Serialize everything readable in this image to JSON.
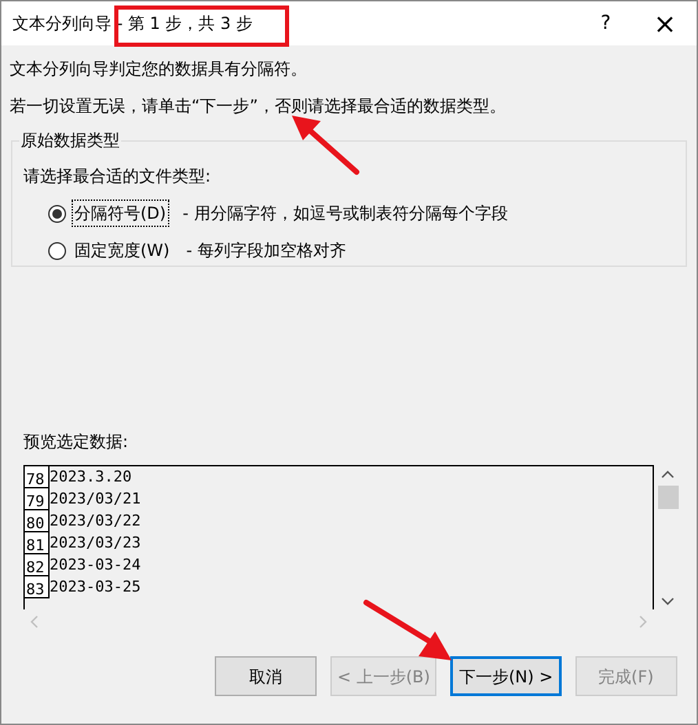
{
  "window": {
    "title": "文本分列向导 - 第 1 步，共 3 步",
    "help": "?",
    "close": "×"
  },
  "messages": [
    "文本分列向导判定您的数据具有分隔符。",
    "若一切设置无误，请单击“下一步”，否则请选择最合适的数据类型。"
  ],
  "group": {
    "legend": "原始数据类型",
    "prompt": "请选择最合适的文件类型:",
    "options": [
      {
        "label": "分隔符号(D)",
        "description": "- 用分隔字符，如逗号或制表符分隔每个字段",
        "selected": true
      },
      {
        "label": "固定宽度(W)",
        "description": "- 每列字段加空格对齐",
        "selected": false
      }
    ]
  },
  "preview": {
    "label": "预览选定数据:",
    "rows": [
      {
        "number": "78",
        "value": "2023.3.20"
      },
      {
        "number": "79",
        "value": "2023/03/21"
      },
      {
        "number": "80",
        "value": "2023/03/22"
      },
      {
        "number": "81",
        "value": "2023/03/23"
      },
      {
        "number": "82",
        "value": "2023-03-24"
      },
      {
        "number": "83",
        "value": "2023-03-25"
      }
    ]
  },
  "buttons": [
    {
      "label": "取消",
      "default": false,
      "disabled": false
    },
    {
      "label": "< 上一步(B)",
      "default": false,
      "disabled": true
    },
    {
      "label": "下一步(N) >",
      "default": true,
      "disabled": false
    },
    {
      "label": "完成(F)",
      "default": false,
      "disabled": true
    }
  ]
}
